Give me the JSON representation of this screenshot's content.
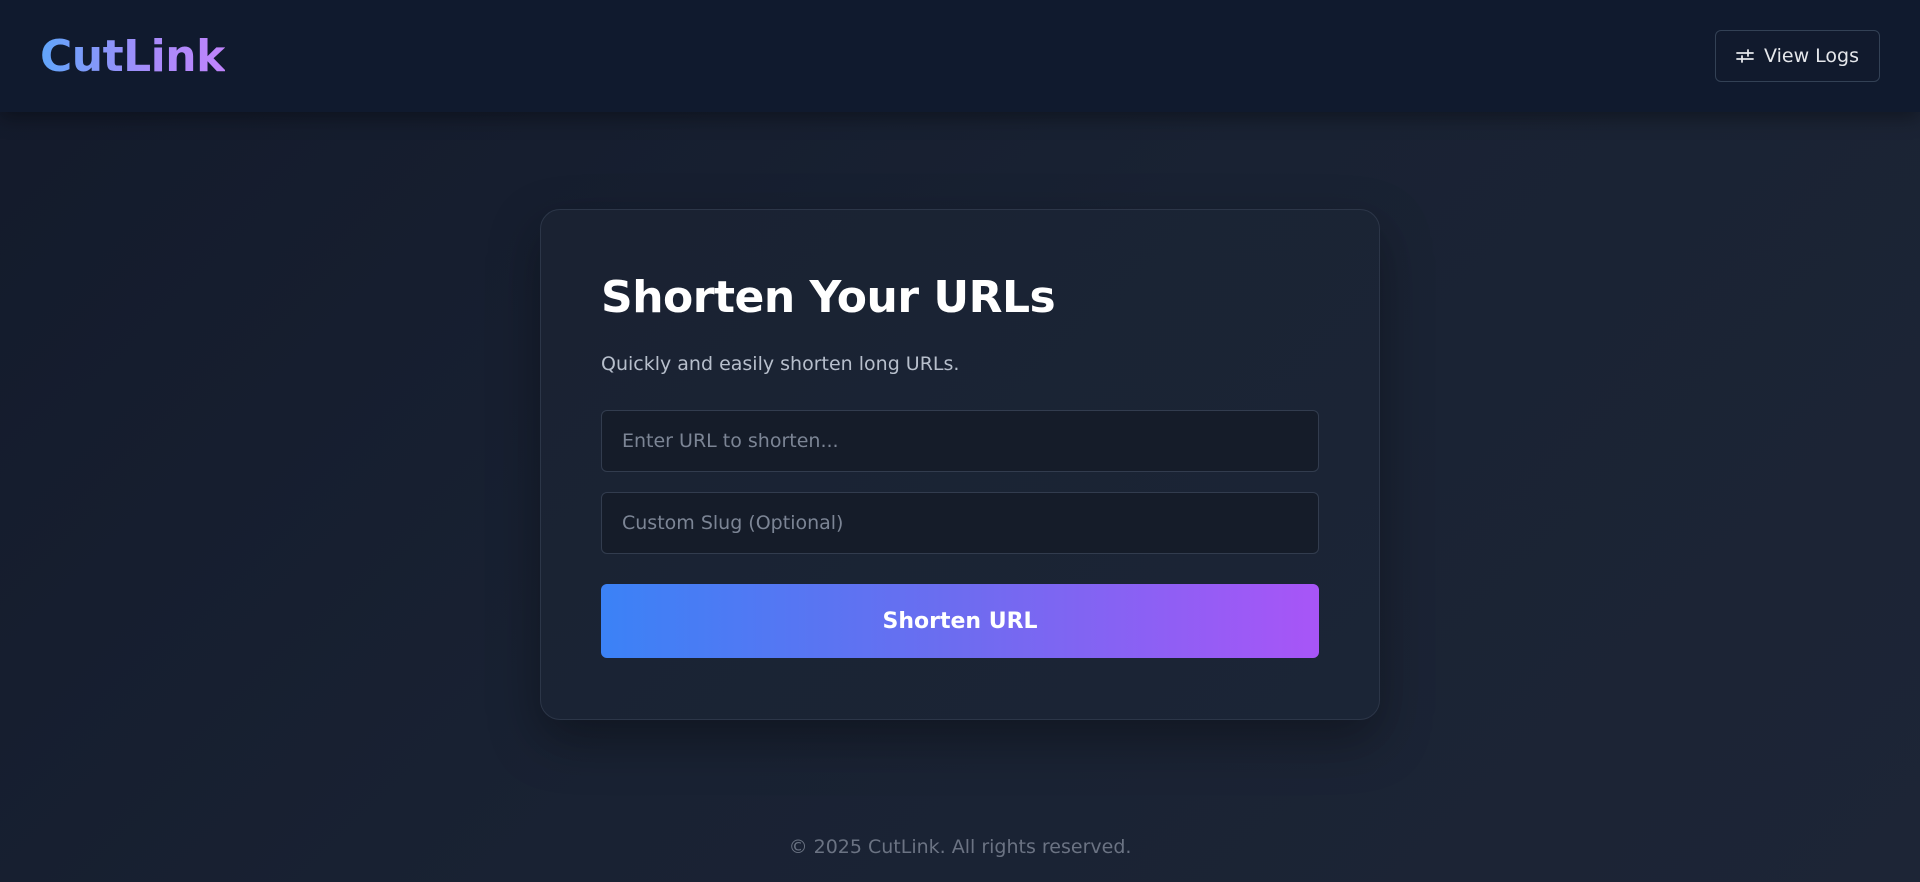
{
  "header": {
    "logo": "CutLink",
    "logs_button": {
      "label": "View Logs",
      "icon": "sliders-icon"
    }
  },
  "card": {
    "title": "Shorten Your URLs",
    "subtitle": "Quickly and easily shorten long URLs.",
    "url_input": {
      "value": "",
      "placeholder": "Enter URL to shorten..."
    },
    "slug_input": {
      "value": "",
      "placeholder": "Custom Slug (Optional)"
    },
    "submit_label": "Shorten URL"
  },
  "footer": {
    "text": "© 2025 CutLink. All rights reserved."
  },
  "colors": {
    "background": "#1a2232",
    "header": "#101a2e",
    "accent_start": "#3b82f6",
    "accent_end": "#a855f7"
  }
}
